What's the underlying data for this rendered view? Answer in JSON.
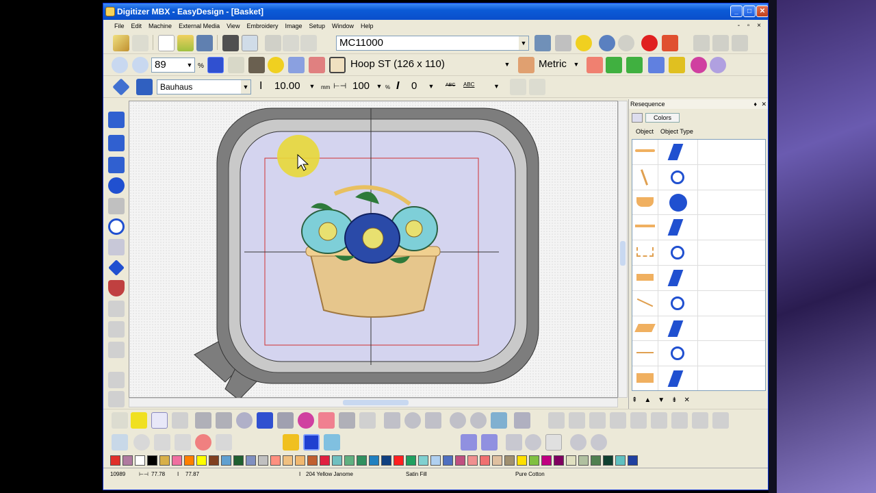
{
  "window": {
    "title": "Digitizer MBX - EasyDesign - [Basket]",
    "controls": [
      "_",
      "□",
      "✕"
    ],
    "mdi_controls": "- ▫ ×"
  },
  "menu": [
    "File",
    "Edit",
    "Machine",
    "External Media",
    "View",
    "Embroidery",
    "Image",
    "Setup",
    "Window",
    "Help"
  ],
  "toolbar1": {
    "machine_combo": "MC11000"
  },
  "toolbar2": {
    "zoom_value": "89",
    "zoom_unit": "%",
    "hoop_combo": "Hoop ST (126 x 110)",
    "units_combo": "Metric"
  },
  "toolbar3": {
    "font_combo": "Bauhaus",
    "height_value": "10.00",
    "height_unit": "mm",
    "width_value": "100",
    "width_unit": "%",
    "slant_value": "0",
    "abc1": "ABC",
    "abc2": "ABC"
  },
  "panel": {
    "title": "Resequence",
    "colors_button": "Colors",
    "col_object": "Object",
    "col_type": "Object Type",
    "pin": "♦",
    "close": "✕"
  },
  "palette_colors": [
    "#e0302a",
    "#b07aa0",
    "#ffffff",
    "#000000",
    "#d8b048",
    "#f070a0",
    "#ff8000",
    "#ffff00",
    "#804020",
    "#60a0d0",
    "#206030",
    "#8090c0",
    "#c0c0c0",
    "#ff9080",
    "#f0c080",
    "#f0b870",
    "#c06030",
    "#e02040",
    "#70c0c0",
    "#60b080",
    "#309060",
    "#2080c0",
    "#104080",
    "#ff2020",
    "#20a060",
    "#80d0d0",
    "#b0d0f0",
    "#5070c0",
    "#c05080",
    "#f09090",
    "#f07070",
    "#e0c0a0",
    "#a09070",
    "#ffe000",
    "#80c040",
    "#c00080",
    "#800060",
    "#e0e0c0",
    "#b0c0a0",
    "#508050",
    "#104030",
    "#60c0c0",
    "#2040a0"
  ],
  "status": {
    "stitches": "10989",
    "width": "77.78",
    "height": "77.87",
    "thread": "204 Yellow Janome",
    "fill": "Satin Fill",
    "material": "Pure Cotton"
  },
  "colors": {
    "titlebar": "#0a4ecb",
    "hoop_gray": "#7d7d7d",
    "design_bg": "#d4d4ef",
    "cursor_highlight": "#e8d838"
  }
}
